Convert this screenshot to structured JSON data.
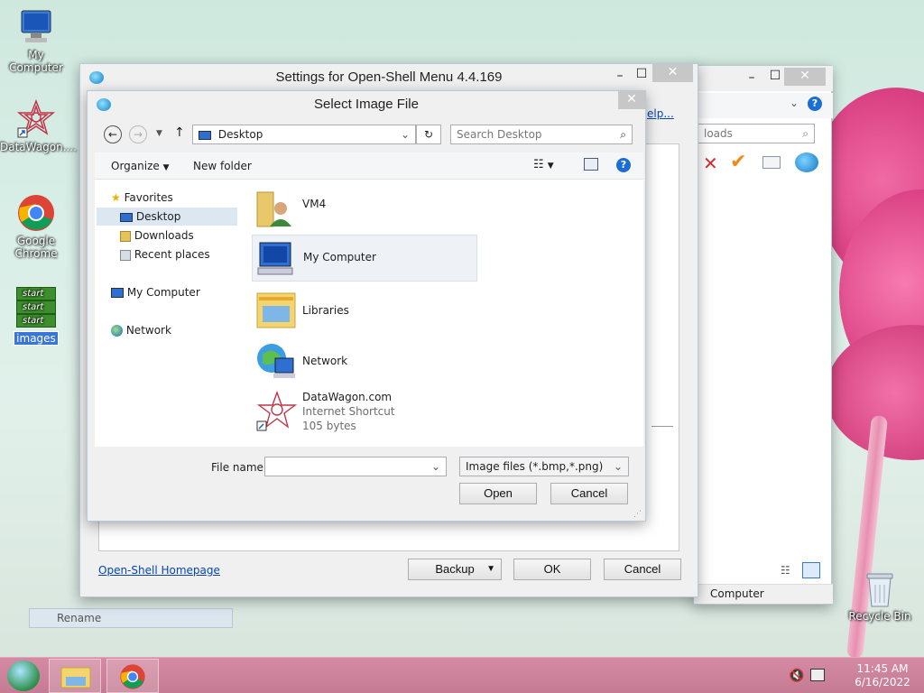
{
  "desktop": {
    "icons": [
      {
        "label": "My Computer",
        "icon": "computer-icon"
      },
      {
        "label": "DataWagon....",
        "icon": "datawagon-shortcut-icon"
      },
      {
        "label": "Google Chrome",
        "icon": "chrome-icon"
      },
      {
        "label": "images",
        "icon": "start-images-icon"
      },
      {
        "label": "Recycle Bin",
        "icon": "recycle-bin-icon"
      }
    ],
    "start_tiles": [
      "start",
      "start",
      "start"
    ]
  },
  "rename_bar": {
    "label": "Rename"
  },
  "back_window": {
    "search_placeholder": "loads",
    "status_label": "Computer"
  },
  "settings_window": {
    "title": "Settings for Open-Shell Menu 4.4.169",
    "help_link": "elp...",
    "homepage_link": "Open-Shell Homepage",
    "buttons": {
      "backup": "Backup",
      "ok": "OK",
      "cancel": "Cancel"
    }
  },
  "dialog": {
    "title": "Select Image File",
    "address": "Desktop",
    "search_placeholder": "Search Desktop",
    "toolbar": {
      "organize": "Organize",
      "new_folder": "New folder"
    },
    "nav_tree": {
      "favorites": "Favorites",
      "favorites_items": [
        "Desktop",
        "Downloads",
        "Recent places"
      ],
      "my_computer": "My Computer",
      "network": "Network"
    },
    "files": [
      {
        "name": "VM4",
        "icon": "user-folder-icon"
      },
      {
        "name": "My Computer",
        "icon": "computer-icon"
      },
      {
        "name": "Libraries",
        "icon": "libraries-icon"
      },
      {
        "name": "Network",
        "icon": "network-icon"
      },
      {
        "name": "DataWagon.com",
        "type": "Internet Shortcut",
        "size": "105 bytes",
        "icon": "datawagon-shortcut-icon"
      }
    ],
    "file_name_label": "File name:",
    "file_name_value": "",
    "file_type": "Image files (*.bmp,*.png)",
    "buttons": {
      "open": "Open",
      "cancel": "Cancel"
    }
  },
  "taskbar": {
    "time": "11:45 AM",
    "date": "6/16/2022"
  }
}
